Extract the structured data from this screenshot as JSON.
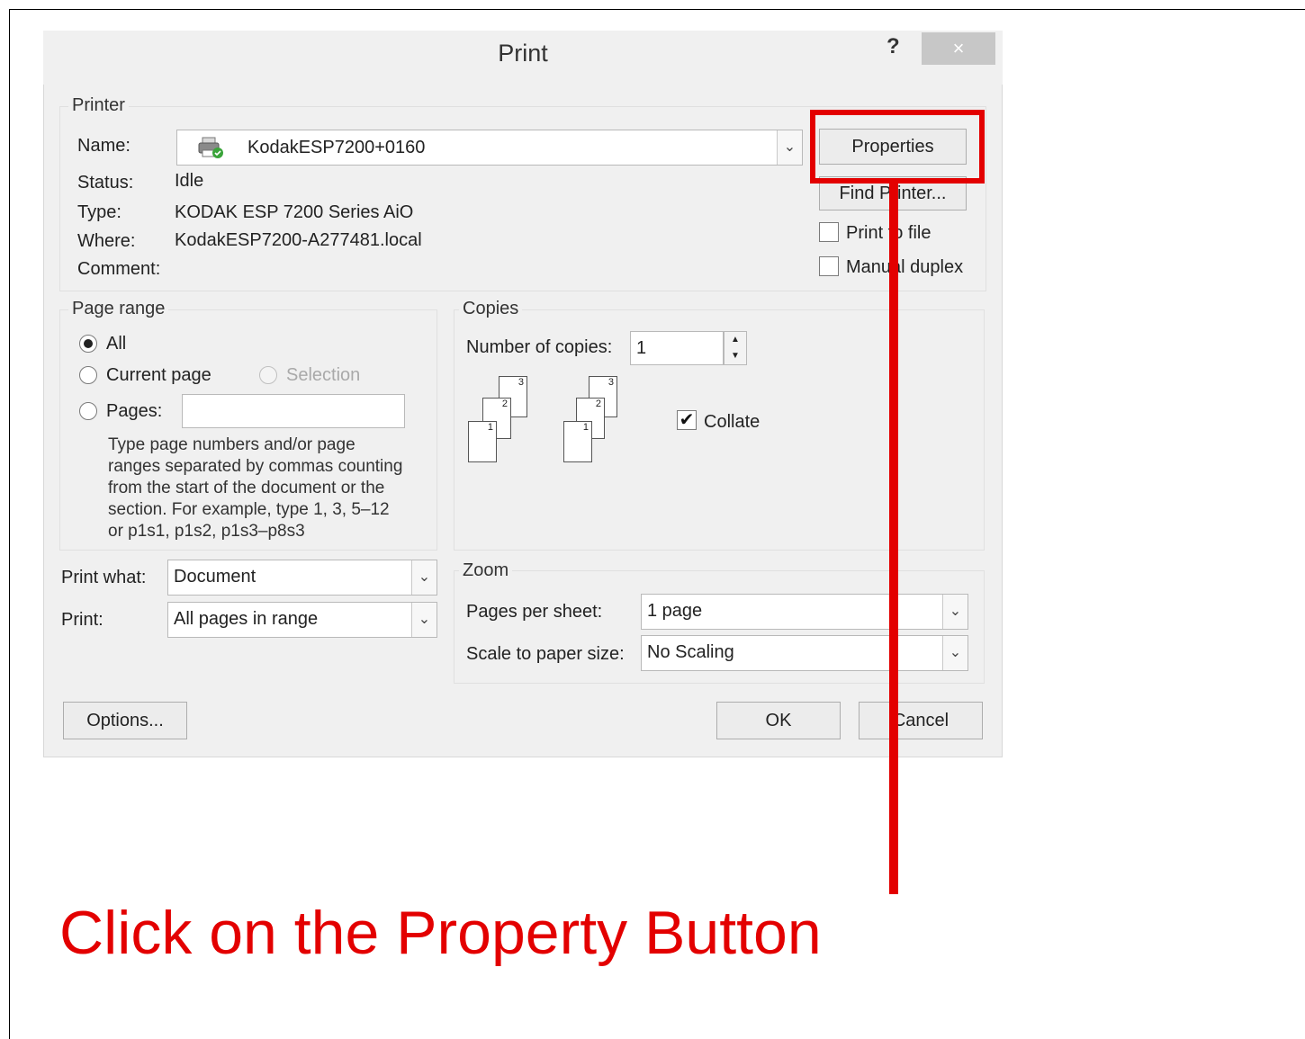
{
  "dialog": {
    "title": "Print",
    "help": "?",
    "close": "×"
  },
  "printer": {
    "legend": "Printer",
    "name_label": "Name:",
    "name_value": "KodakESP7200+0160",
    "status_label": "Status:",
    "status_value": "Idle",
    "type_label": "Type:",
    "type_value": "KODAK ESP 7200 Series AiO",
    "where_label": "Where:",
    "where_value": "KodakESP7200-A277481.local",
    "comment_label": "Comment:",
    "properties_button": "Properties",
    "find_printer_button": "Find Printer...",
    "print_to_file_label": "Print to file",
    "manual_duplex_label": "Manual duplex"
  },
  "page_range": {
    "legend": "Page range",
    "all_label": "All",
    "current_page_label": "Current page",
    "selection_label": "Selection",
    "pages_label": "Pages:",
    "help_lines": [
      "Type page numbers and/or page",
      "ranges separated by commas counting",
      "from the start of the document or the",
      "section. For example, type 1, 3, 5–12",
      "or p1s1, p1s2, p1s3–p8s3"
    ]
  },
  "copies": {
    "legend": "Copies",
    "number_label": "Number of copies:",
    "number_value": "1",
    "collate_label": "Collate",
    "collate_checked": true
  },
  "print_what": {
    "label": "Print what:",
    "value": "Document"
  },
  "print": {
    "label": "Print:",
    "value": "All pages in range"
  },
  "zoom": {
    "legend": "Zoom",
    "pages_per_sheet_label": "Pages per sheet:",
    "pages_per_sheet_value": "1 page",
    "scale_label": "Scale to paper size:",
    "scale_value": "No Scaling"
  },
  "buttons": {
    "options": "Options...",
    "ok": "OK",
    "cancel": "Cancel"
  },
  "annotation": {
    "caption": "Click on the Property Button",
    "color": "#e30000"
  }
}
